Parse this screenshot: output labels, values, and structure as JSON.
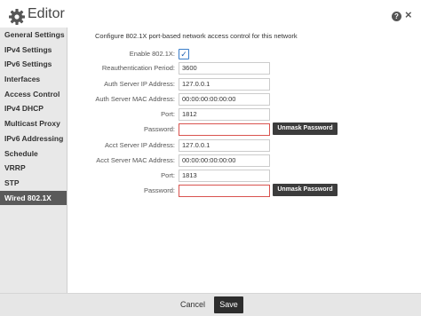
{
  "header": {
    "title": "Editor",
    "help_glyph": "?",
    "close_glyph": "×",
    "icons": {
      "title": "gear-icon",
      "help": "help-icon",
      "close": "close-icon"
    }
  },
  "sidebar": {
    "items": [
      {
        "label": "General Settings"
      },
      {
        "label": "IPv4 Settings"
      },
      {
        "label": "IPv6 Settings"
      },
      {
        "label": "Interfaces"
      },
      {
        "label": "Access Control"
      },
      {
        "label": "IPv4 DHCP"
      },
      {
        "label": "Multicast Proxy"
      },
      {
        "label": "IPv6 Addressing"
      },
      {
        "label": "Schedule"
      },
      {
        "label": "VRRP"
      },
      {
        "label": "STP"
      },
      {
        "label": "Wired 802.1X"
      }
    ],
    "active": "Wired 802.1X"
  },
  "main": {
    "description": "Configure 802.1X port-based network access control for this network",
    "enable_label": "Enable 802.1X:",
    "enable_checked": true,
    "reauth_label": "Reauthentication Period:",
    "reauth_value": "3600",
    "auth_ip_label": "Auth Server IP Address:",
    "auth_ip_value": "127.0.0.1",
    "auth_mac_label": "Auth Server MAC Address:",
    "auth_mac_value": "00:00:00:00:00:00",
    "auth_port_label": "Port:",
    "auth_port_value": "1812",
    "auth_password_label": "Password:",
    "auth_password_value": "",
    "unmask_label": "Unmask Password",
    "acct_ip_label": "Acct Server IP Address:",
    "acct_ip_value": "127.0.0.1",
    "acct_mac_label": "Acct Server MAC Address:",
    "acct_mac_value": "00:00:00:00:00:00",
    "acct_port_label": "Port:",
    "acct_port_value": "1813",
    "acct_password_label": "Password:",
    "acct_password_value": ""
  },
  "footer": {
    "cancel_label": "Cancel",
    "save_label": "Save"
  },
  "colors": {
    "sidebar_bg": "#e8e8e8",
    "active_item_bg": "#5a5a5a",
    "error_border": "#d9534f",
    "button_dark": "#2d2d2d"
  }
}
